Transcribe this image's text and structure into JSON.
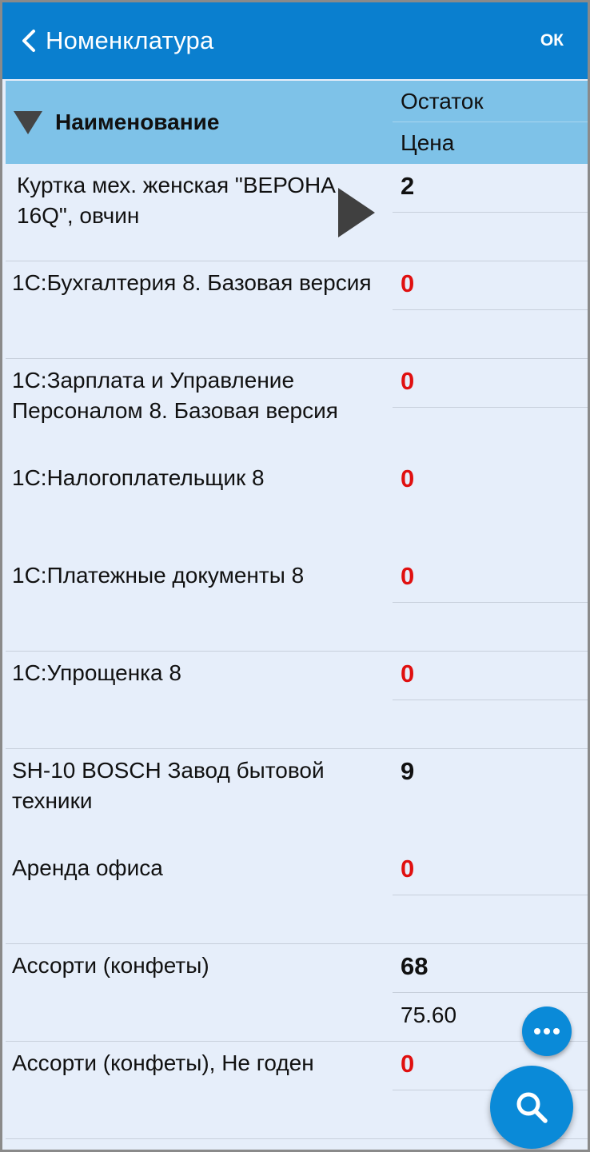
{
  "app_bar": {
    "title": "Номенклатура",
    "ok_label": "ОК",
    "color": "#0a7fcf"
  },
  "table": {
    "header": {
      "name_label": "Наименование",
      "stock_label": "Остаток",
      "price_label": "Цена",
      "sort_icon": "sort-desc-triangle-icon",
      "color": "#7ec2e8"
    },
    "rows": [
      {
        "name": "Куртка мех. женская \"ВЕРОНА 16Q\", овчин",
        "stock": "2",
        "price": "",
        "stock_zero": false,
        "expandable": true
      },
      {
        "name": "1С:Бухгалтерия 8. Базовая версия",
        "stock": "0",
        "price": "",
        "stock_zero": true
      },
      {
        "name": "1С:Зарплата и Управление Персоналом 8. Базовая версия",
        "stock": "0",
        "price": "",
        "stock_zero": true
      },
      {
        "name": "1С:Налогоплательщик 8",
        "stock": "0",
        "price": "",
        "stock_zero": true
      },
      {
        "name": "1С:Платежные документы 8",
        "stock": "0",
        "price": "",
        "stock_zero": true
      },
      {
        "name": "1С:Упрощенка 8",
        "stock": "0",
        "price": "",
        "stock_zero": true
      },
      {
        "name": "SH-10 BOSCH Завод бытовой техники",
        "stock": "9",
        "price": "",
        "stock_zero": false
      },
      {
        "name": "Аренда офиса",
        "stock": "0",
        "price": "",
        "stock_zero": true
      },
      {
        "name": "Ассорти (конфеты)",
        "stock": "68",
        "price": "75.60",
        "stock_zero": false
      },
      {
        "name": "Ассорти (конфеты), Не годен",
        "stock": "0",
        "price": "",
        "stock_zero": true
      }
    ]
  },
  "colors": {
    "row_background": "#e6eefa",
    "zero_stock": "#e01010",
    "fab": "#0a8ad8"
  },
  "fabs": {
    "more_icon": "more-horizontal-icon",
    "search_icon": "search-icon"
  }
}
